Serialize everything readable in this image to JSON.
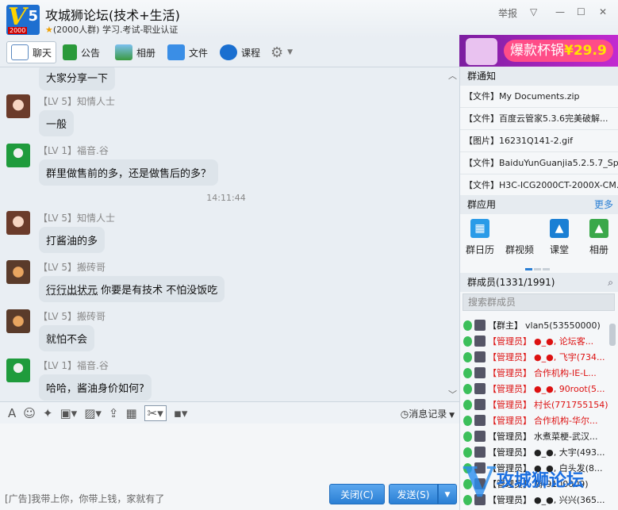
{
  "window": {
    "group_name": "攻城狮论坛(技术+生活)",
    "group_sub": "(2000人群) 学习.考试-职业认证",
    "logo_year": "2000",
    "report": "举报",
    "controls": [
      "▽",
      "—",
      "☐",
      "✕"
    ]
  },
  "toolbar": {
    "items": [
      {
        "label": "聊天",
        "icon": "chat-icon"
      },
      {
        "label": "公告",
        "icon": "flag-icon"
      },
      {
        "label": "相册",
        "icon": "photo-icon"
      },
      {
        "label": "文件",
        "icon": "folder-icon"
      },
      {
        "label": "课程",
        "icon": "course-icon"
      }
    ],
    "settings_icon": "gear-icon"
  },
  "banner": {
    "text": "爆款杯锅",
    "price": "¥29.9"
  },
  "chat": {
    "messages": [
      {
        "sender": "",
        "text": "大家分享一下",
        "avatar": "none"
      },
      {
        "sender": "【LV 5】知情人士",
        "text": "一般",
        "avatar": "girl"
      },
      {
        "sender": "【LV 1】福音.谷",
        "text": "群里做售前的多，还是做售后的多？",
        "avatar": "boy"
      },
      {
        "sender": "【LV 5】知情人士",
        "text": "打酱油的多",
        "avatar": "girl"
      },
      {
        "sender": "【LV 5】搬砖哥",
        "text_link": "行行出状元",
        "text_rest": " 你要是有技术 不怕没饭吃",
        "avatar": "cat"
      },
      {
        "sender": "【LV 5】搬砖哥",
        "text": "就怕不会",
        "avatar": "cat"
      },
      {
        "sender": "【LV 1】福音.谷",
        "text": "哈哈，酱油身价如何?",
        "avatar": "boy"
      }
    ],
    "timestamp": "14:11:44"
  },
  "input": {
    "history_label": "消息记录",
    "ad_text": "[广告]我带上你，你带上钱，家就有了",
    "close_label": "关闭(C)",
    "send_label": "发送(S)",
    "send_arrow": "▼"
  },
  "side": {
    "notice_title": "群通知",
    "files": [
      "【文件】My Documents.zip",
      "【文件】百度云管家5.3.6完美破解...",
      "【图片】16231Q141-2.gif",
      "【文件】BaiduYunGuanjia5.2.5.7_Sp...",
      "【文件】H3C-ICG2000CT-2000X-CM..."
    ],
    "apps_title": "群应用",
    "apps_more": "更多",
    "apps": [
      {
        "label": "群日历",
        "icon": "calendar-icon",
        "color": "#2a9be8"
      },
      {
        "label": "群视频",
        "icon": "video-icon",
        "color": "#1a7fd4"
      },
      {
        "label": "课堂",
        "icon": "classroom-icon",
        "color": "#1a7fd4"
      },
      {
        "label": "相册",
        "icon": "album-icon",
        "color": "#3aa84a"
      }
    ],
    "members_title": "群成员(1331/1991)",
    "member_search_placeholder": "搜索群成员",
    "members": [
      {
        "role": "【群主】",
        "name": "vlan5(53550000)",
        "red": false
      },
      {
        "role": "【管理员】",
        "name": "●_●, 论坛客...",
        "red": true
      },
      {
        "role": "【管理员】",
        "name": "●_●, 飞宇(734...",
        "red": true
      },
      {
        "role": "【管理员】",
        "name": "合作机构-IE-L...",
        "red": true
      },
      {
        "role": "【管理员】",
        "name": "●_●, 90root(5...",
        "red": true
      },
      {
        "role": "【管理员】",
        "name": "村长(771755154)",
        "red": true
      },
      {
        "role": "【管理员】",
        "name": "合作机构-华尔...",
        "red": true
      },
      {
        "role": "【管理员】",
        "name": "水煮菜梗-武汉...",
        "red": false
      },
      {
        "role": "【管理员】",
        "name": "●_●, 大宇(493...",
        "red": false
      },
      {
        "role": "【管理员】",
        "name": "●_●, 白头发(8...",
        "red": false
      },
      {
        "role": "【管理员】",
        "name": "骑(9100009)",
        "red": false
      },
      {
        "role": "【管理员】",
        "name": "●_●, 兴兴(365...",
        "red": false
      }
    ],
    "watermark": "攻城狮论坛"
  }
}
